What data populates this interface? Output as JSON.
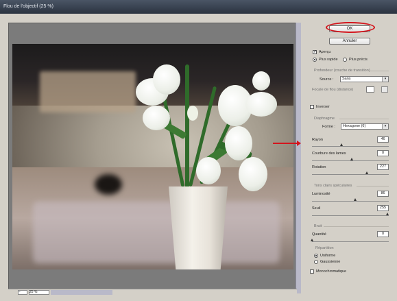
{
  "window": {
    "title": "Flou de l'objectif (25 %)"
  },
  "buttons": {
    "ok": "OK",
    "cancel": "Annuler"
  },
  "preview_opts": {
    "apercu": {
      "label": "Aperçu",
      "checked": true
    },
    "plus_rapide": {
      "label": "Plus rapide",
      "selected": true
    },
    "plus_precis": {
      "label": "Plus précis",
      "selected": false
    }
  },
  "depth_map": {
    "group": "Profondeur (couche de transition)",
    "source_label": "Source :",
    "source_value": "Sans",
    "focal_label": "Focale de flou (distance)",
    "invert": {
      "label": "Inverser",
      "checked": false
    }
  },
  "iris": {
    "group": "Diaphragme",
    "shape_label": "Forme :",
    "shape_value": "Hexagone (6)",
    "radius": {
      "label": "Rayon",
      "value": "46"
    },
    "curvature": {
      "label": "Courbure des lames",
      "value": "0"
    },
    "rotation": {
      "label": "Rotation",
      "value": "227"
    }
  },
  "specular": {
    "group": "Tons clairs spéculaires",
    "brightness": {
      "label": "Luminosité",
      "value": "86"
    },
    "threshold": {
      "label": "Seuil",
      "value": "255"
    }
  },
  "noise": {
    "group": "Bruit",
    "amount": {
      "label": "Quantité",
      "value": "0"
    },
    "distribution_label": "Répartition",
    "uniform": {
      "label": "Uniforme",
      "selected": true
    },
    "gaussian": {
      "label": "Gaussienne",
      "selected": false
    },
    "mono": {
      "label": "Monochromatique",
      "checked": false
    }
  },
  "preview": {
    "zoom_value": "25 %"
  },
  "colors": {
    "highlight_red": "#d4151d",
    "titlebar": "#2b3340"
  },
  "icons": {
    "dropdown": "chevron-down-icon",
    "folder": "square-button-icon",
    "arrow": "red-arrow-annotation"
  }
}
